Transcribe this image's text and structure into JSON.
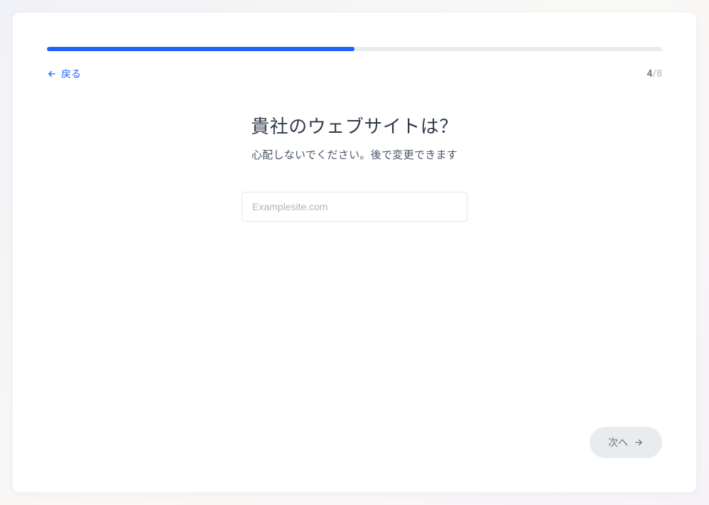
{
  "progress": {
    "percent": 50
  },
  "nav": {
    "back_label": "戻る",
    "step_current": "4",
    "step_separator": "/",
    "step_total": "8"
  },
  "content": {
    "title": "貴社のウェブサイトは？",
    "subtitle": "心配しないでください。後で変更できます"
  },
  "input": {
    "placeholder": "Examplesite.com",
    "value": ""
  },
  "footer": {
    "next_label": "次へ"
  }
}
